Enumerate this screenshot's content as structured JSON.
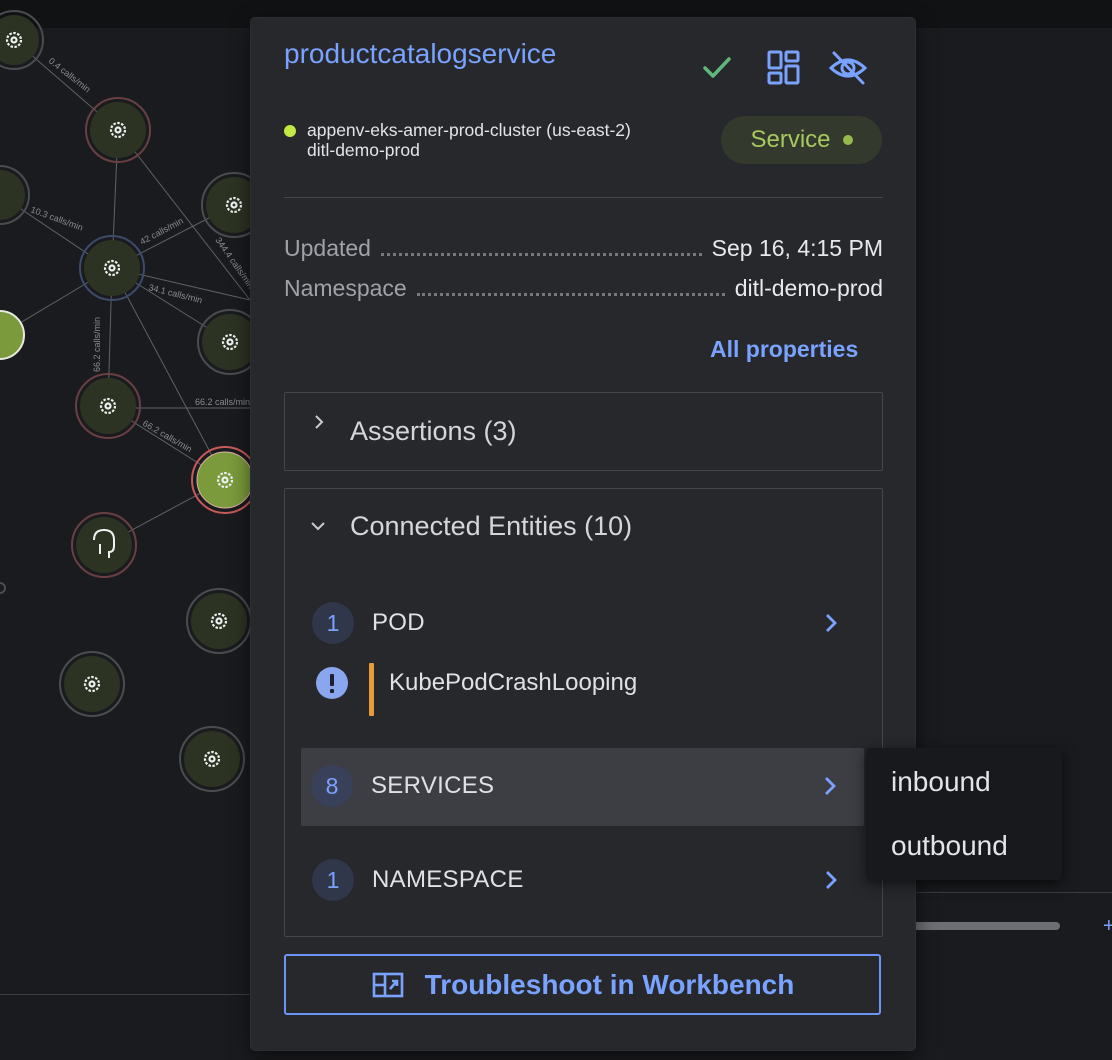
{
  "graph": {
    "edge_labels": [
      "0.4 calls/min",
      "10.3 calls/min",
      "42 calls/min",
      "344.4 calls/min",
      "34.1 calls/min",
      "66.2 calls/min",
      "66.2 calls/min",
      "66.2 calls/min"
    ]
  },
  "panel": {
    "title": "productcatalogservice",
    "header_icons": [
      "check-icon",
      "dashboard-icon",
      "eye-off-icon"
    ],
    "cluster_line1": "appenv-eks-amer-prod-cluster (us-east-2)",
    "cluster_line2": "ditl-demo-prod",
    "type_badge": "Service",
    "colors": {
      "accent": "#7aa2ff",
      "status_green": "#c3e843",
      "alert_orange": "#e89a3a"
    },
    "properties": {
      "updated_key": "Updated",
      "updated_val": "Sep 16, 4:15 PM",
      "namespace_key": "Namespace",
      "namespace_val": "ditl-demo-prod"
    },
    "all_properties": "All properties",
    "assertions": {
      "title": "Assertions (3)"
    },
    "connected": {
      "title": "Connected Entities (10)",
      "pod": {
        "count": "1",
        "label": "POD"
      },
      "alert": {
        "label": "KubePodCrashLooping"
      },
      "services": {
        "count": "8",
        "label": "SERVICES"
      },
      "namespace": {
        "count": "1",
        "label": "NAMESPACE"
      }
    },
    "workbench_button": "Troubleshoot in Workbench"
  },
  "dropdown": {
    "items": [
      "inbound",
      "outbound"
    ]
  }
}
